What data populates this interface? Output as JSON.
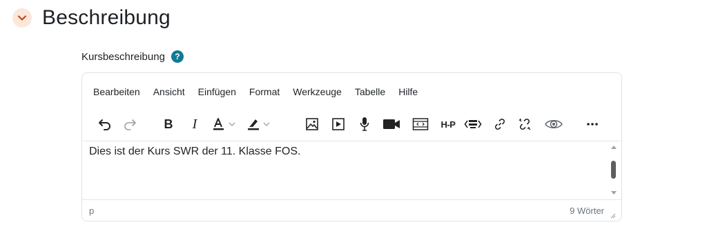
{
  "section": {
    "title": "Beschreibung",
    "toggle_icon": "chevron-down-icon",
    "accent_color": "#c2410c"
  },
  "field": {
    "label": "Kursbeschreibung",
    "help_icon": "question-icon"
  },
  "editor": {
    "menubar": [
      "Bearbeiten",
      "Ansicht",
      "Einfügen",
      "Format",
      "Werkzeuge",
      "Tabelle",
      "Hilfe"
    ],
    "toolbar": {
      "h5p_label": "H-P",
      "buttons": [
        "undo-icon",
        "redo-icon",
        "bold-icon",
        "italic-icon",
        "text-color-icon",
        "highlight-color-icon",
        "image-icon",
        "media-icon",
        "record-audio-icon",
        "record-video-icon",
        "embed-icon",
        "h5p-icon",
        "html-source-icon",
        "link-icon",
        "unlink-icon",
        "preview-icon",
        "more-icon"
      ]
    },
    "content": "Dies ist der Kurs SWR der 11. Klasse FOS.",
    "status_path": "p",
    "word_count": "9 Wörter"
  }
}
